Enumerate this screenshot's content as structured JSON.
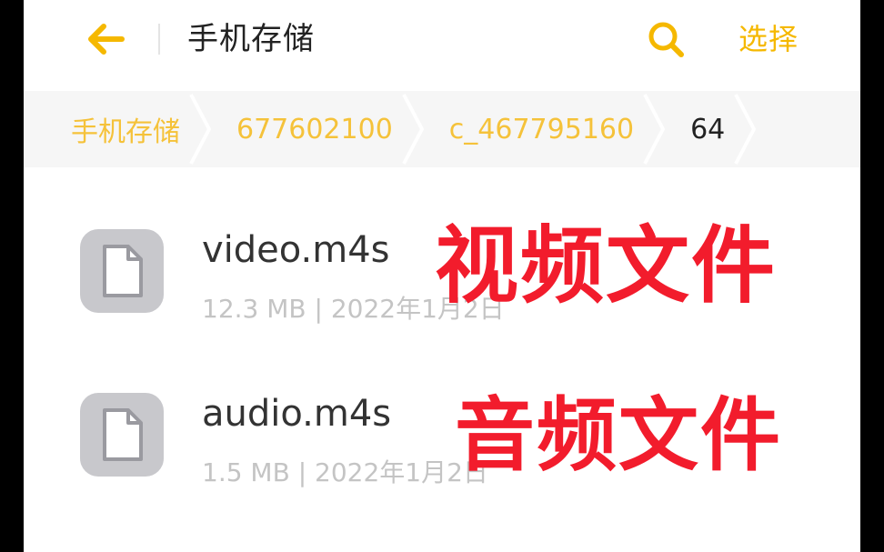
{
  "header": {
    "title": "手机存储",
    "select_label": "选择"
  },
  "breadcrumb": [
    {
      "label": "手机存储"
    },
    {
      "label": "677602100"
    },
    {
      "label": "c_467795160"
    },
    {
      "label": "64"
    }
  ],
  "files": [
    {
      "name": "video.m4s",
      "meta": "12.3 MB | 2022年1月2日",
      "overlay": "视频文件"
    },
    {
      "name": "audio.m4s",
      "meta": "1.5 MB | 2022年1月2日",
      "overlay": "音频文件"
    }
  ],
  "colors": {
    "accent": "#f5b800",
    "overlay_red": "#f21c2c",
    "icon_bg": "#c8c8cc"
  },
  "icons": {
    "back": "arrow-left-icon",
    "search": "search-icon",
    "file": "document-icon",
    "chevron": "chevron-right-icon"
  }
}
